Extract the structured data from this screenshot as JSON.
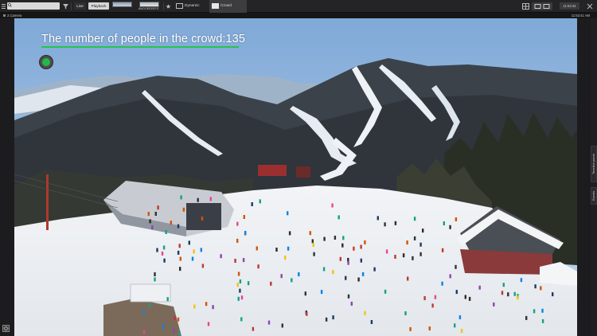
{
  "toolbar": {
    "search_placeholder": "",
    "live_label": "Live",
    "playback_label": "Playback",
    "thumbs": [
      {
        "label": ""
      },
      {
        "label": "ANOOEEEEFG"
      }
    ],
    "dynamic_layout_label": "Dynamic layout",
    "crowd_detector_label": "Crowd Detector",
    "clock_label": "11:53:44",
    "accent_color": "#e8e8e8"
  },
  "subbar": {
    "camera_name": "2.Camera",
    "time_right": "11:53:41 AM"
  },
  "video": {
    "overlay_title": "The number of people in the crowd:135",
    "status_color": "#24b84a",
    "underline_color": "#27c44a"
  },
  "sidepanel": {
    "tabs": [
      "Timeline panel",
      "Events"
    ]
  }
}
